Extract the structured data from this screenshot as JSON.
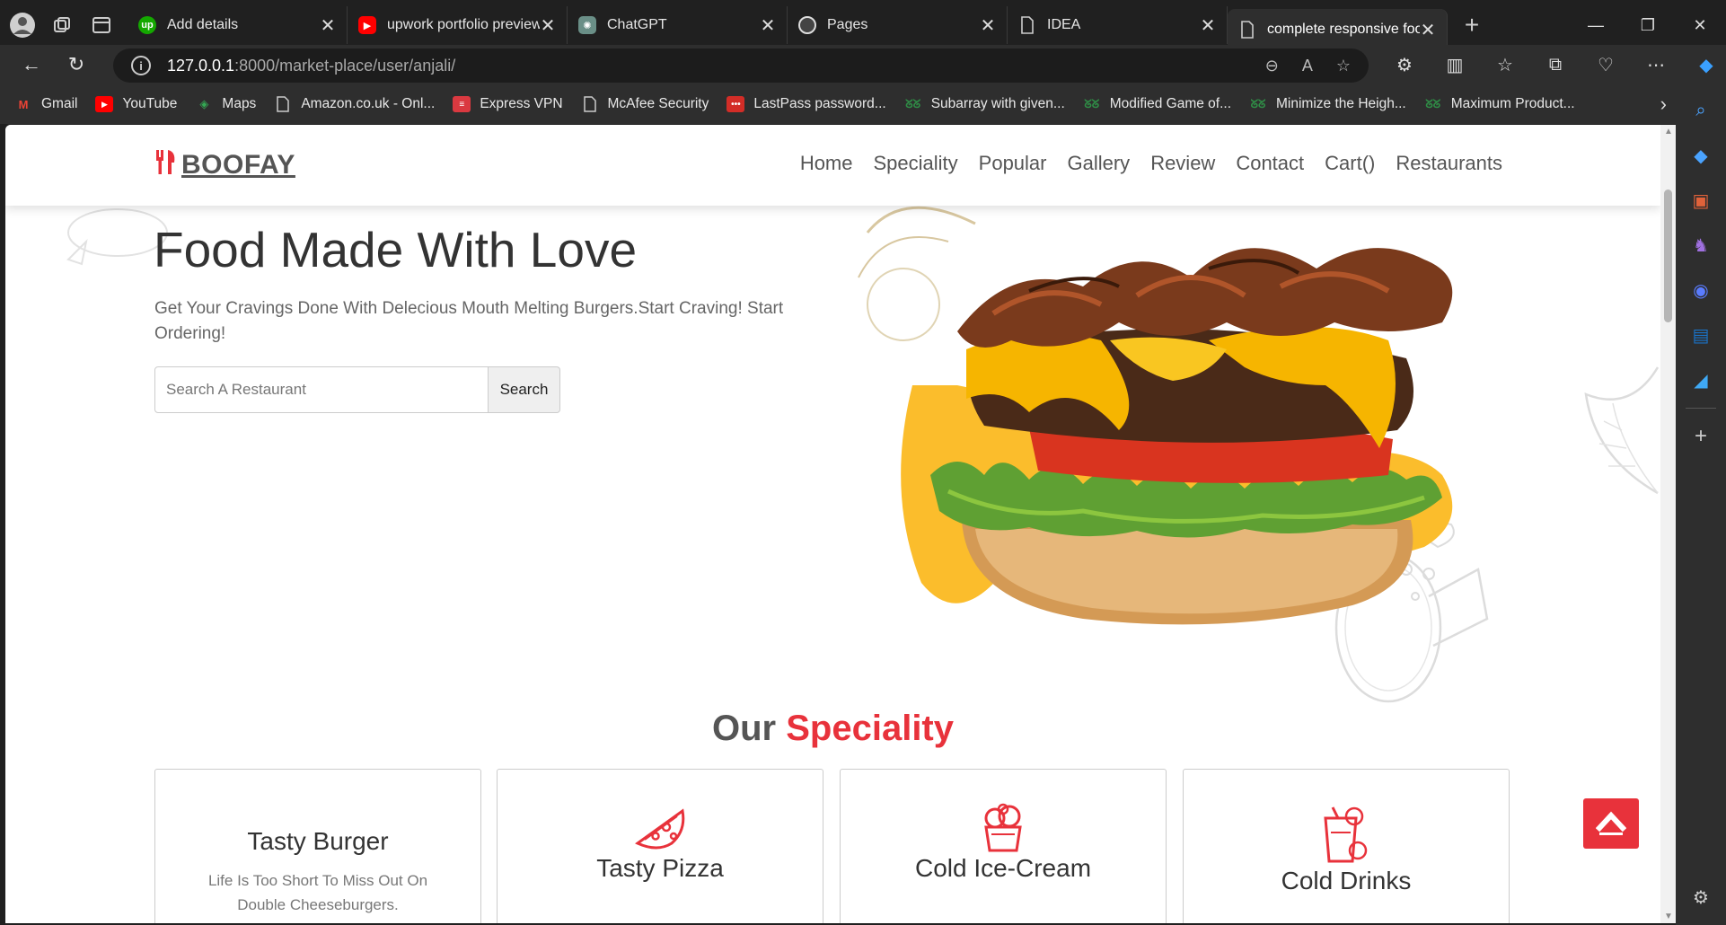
{
  "browser": {
    "tabs": [
      {
        "title": "Add details",
        "favicon": "upwork-icon"
      },
      {
        "title": "upwork portfolio preview",
        "favicon": "youtube-icon"
      },
      {
        "title": "ChatGPT",
        "favicon": "chatgpt-icon"
      },
      {
        "title": "Pages",
        "favicon": "github-icon"
      },
      {
        "title": "IDEA",
        "favicon": "page-icon"
      },
      {
        "title": "complete responsive food",
        "favicon": "page-icon",
        "active": true
      }
    ],
    "url_host": "127.0.0.1",
    "url_path": ":8000/market-place/user/anjali/",
    "bookmarks": [
      {
        "label": "Gmail",
        "icon": "gmail-icon"
      },
      {
        "label": "YouTube",
        "icon": "youtube-icon"
      },
      {
        "label": "Maps",
        "icon": "maps-icon"
      },
      {
        "label": "Amazon.co.uk - Onl...",
        "icon": "page-icon"
      },
      {
        "label": "Express VPN",
        "icon": "expressvpn-icon"
      },
      {
        "label": "McAfee Security",
        "icon": "page-icon"
      },
      {
        "label": "LastPass password...",
        "icon": "lastpass-icon"
      },
      {
        "label": "Subarray with given...",
        "icon": "gfg-icon"
      },
      {
        "label": "Modified Game of...",
        "icon": "gfg-icon"
      },
      {
        "label": "Minimize the Heigh...",
        "icon": "gfg-icon"
      },
      {
        "label": "Maximum Product...",
        "icon": "gfg-icon"
      }
    ]
  },
  "site": {
    "logo": "BOOFAY",
    "nav": [
      "Home",
      "Speciality",
      "Popular",
      "Gallery",
      "Review",
      "Contact",
      "Cart()",
      "Restaurants"
    ],
    "hero": {
      "title": "Food Made With Love",
      "text": "Get Your Cravings Done With Delecious Mouth Melting Burgers.Start Craving! Start Ordering!",
      "search_placeholder": "Search A Restaurant",
      "search_button": "Search"
    },
    "speciality": {
      "title_main": "Our",
      "title_accent": "Speciality",
      "cards": [
        {
          "title": "Tasty Burger",
          "text": "Life Is Too Short To Miss Out On Double Cheeseburgers."
        },
        {
          "title": "Tasty Pizza",
          "text": ""
        },
        {
          "title": "Cold Ice-Cream",
          "text": ""
        },
        {
          "title": "Cold Drinks",
          "text": ""
        }
      ]
    }
  },
  "colors": {
    "accent": "#e8323b",
    "burger_blob": "#fbbd2c"
  }
}
